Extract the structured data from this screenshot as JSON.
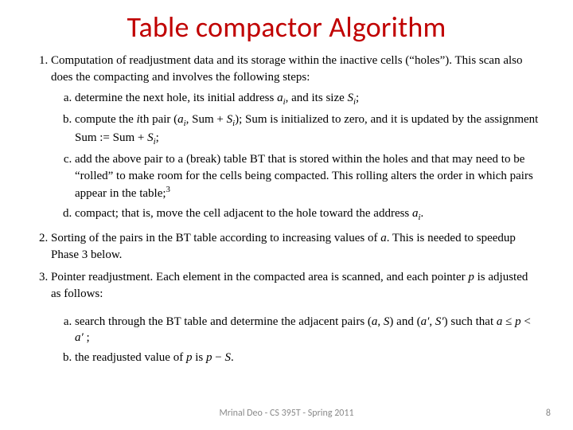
{
  "title": "Table compactor Algorithm",
  "item1_intro": "Computation of readjustment data and its storage within the inactive cells (“holes”). This scan also does the compacting and involves the following steps:",
  "item1a_pre": "determine the next hole, its initial address ",
  "item1a_var1": "a",
  "item1a_sub1": "i",
  "item1a_mid": ", and its size ",
  "item1a_var2": "S",
  "item1a_sub2": "i",
  "item1a_end": ";",
  "item1b_pre": "compute the ",
  "item1b_ith_i": "i",
  "item1b_ith_rest": "th pair (",
  "item1b_var1": "a",
  "item1b_sub1": "i",
  "item1b_mid1": ", Sum + ",
  "item1b_var2": "S",
  "item1b_sub2": "i",
  "item1b_mid2": "); Sum is initialized to zero, and it is updated by the assignment Sum := Sum + ",
  "item1b_var3": "S",
  "item1b_sub3": "i",
  "item1b_end": ";",
  "item1c": "add the above pair to a (break) table BT that is stored within the holes and that may need to be “rolled” to make room for the cells being compacted. This rolling alters the order in which pairs appear in the table;",
  "item1c_fn": "3",
  "item1d_pre": "compact; that is, move the cell adjacent to the hole toward the address ",
  "item1d_var": "a",
  "item1d_sub": "i",
  "item1d_end": ".",
  "item2_pre": "Sorting of the pairs in the BT table according to increasing values of ",
  "item2_var": "a",
  "item2_end": ". This is needed to speedup Phase 3 below.",
  "item3_pre": "Pointer readjustment. Each element in the compacted area is scanned, and each pointer ",
  "item3_var": "p",
  "item3_end": " is adjusted as follows:",
  "item3a_pre": "search through the BT table and determine the adjacent pairs (",
  "item3a_a": "a",
  "item3a_comma1": ", ",
  "item3a_S": "S",
  "item3a_mid": ") and (",
  "item3a_aprime": "a′",
  "item3a_comma2": ", ",
  "item3a_Sprime": "S′",
  "item3a_such": ") such that ",
  "item3a_a2": "a",
  "item3a_le1": " ≤ ",
  "item3a_p": "p",
  "item3a_lt": " < ",
  "item3a_aprime2": "a′",
  "item3a_end": " ;",
  "item3b_pre": "the readjusted value of ",
  "item3b_p1": "p",
  "item3b_is": " is ",
  "item3b_p2": "p",
  "item3b_minus": " − ",
  "item3b_S": "S",
  "item3b_end": ".",
  "footer_center": "Mrinal Deo - CS 395T - Spring 2011",
  "footer_right": "8"
}
